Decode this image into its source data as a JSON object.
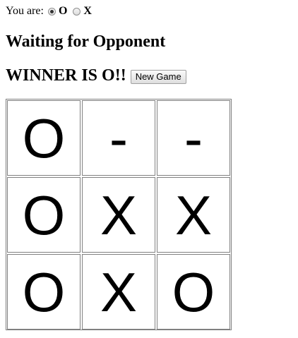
{
  "player": {
    "label": "You are:",
    "options": [
      {
        "label": "O",
        "checked": true
      },
      {
        "label": "X",
        "checked": false
      }
    ]
  },
  "status": "Waiting for Opponent",
  "winner": "WINNER IS O!!",
  "new_game_label": "New Game",
  "board": {
    "cells": [
      "O",
      "-",
      "-",
      "O",
      "X",
      "X",
      "O",
      "X",
      "O"
    ]
  }
}
